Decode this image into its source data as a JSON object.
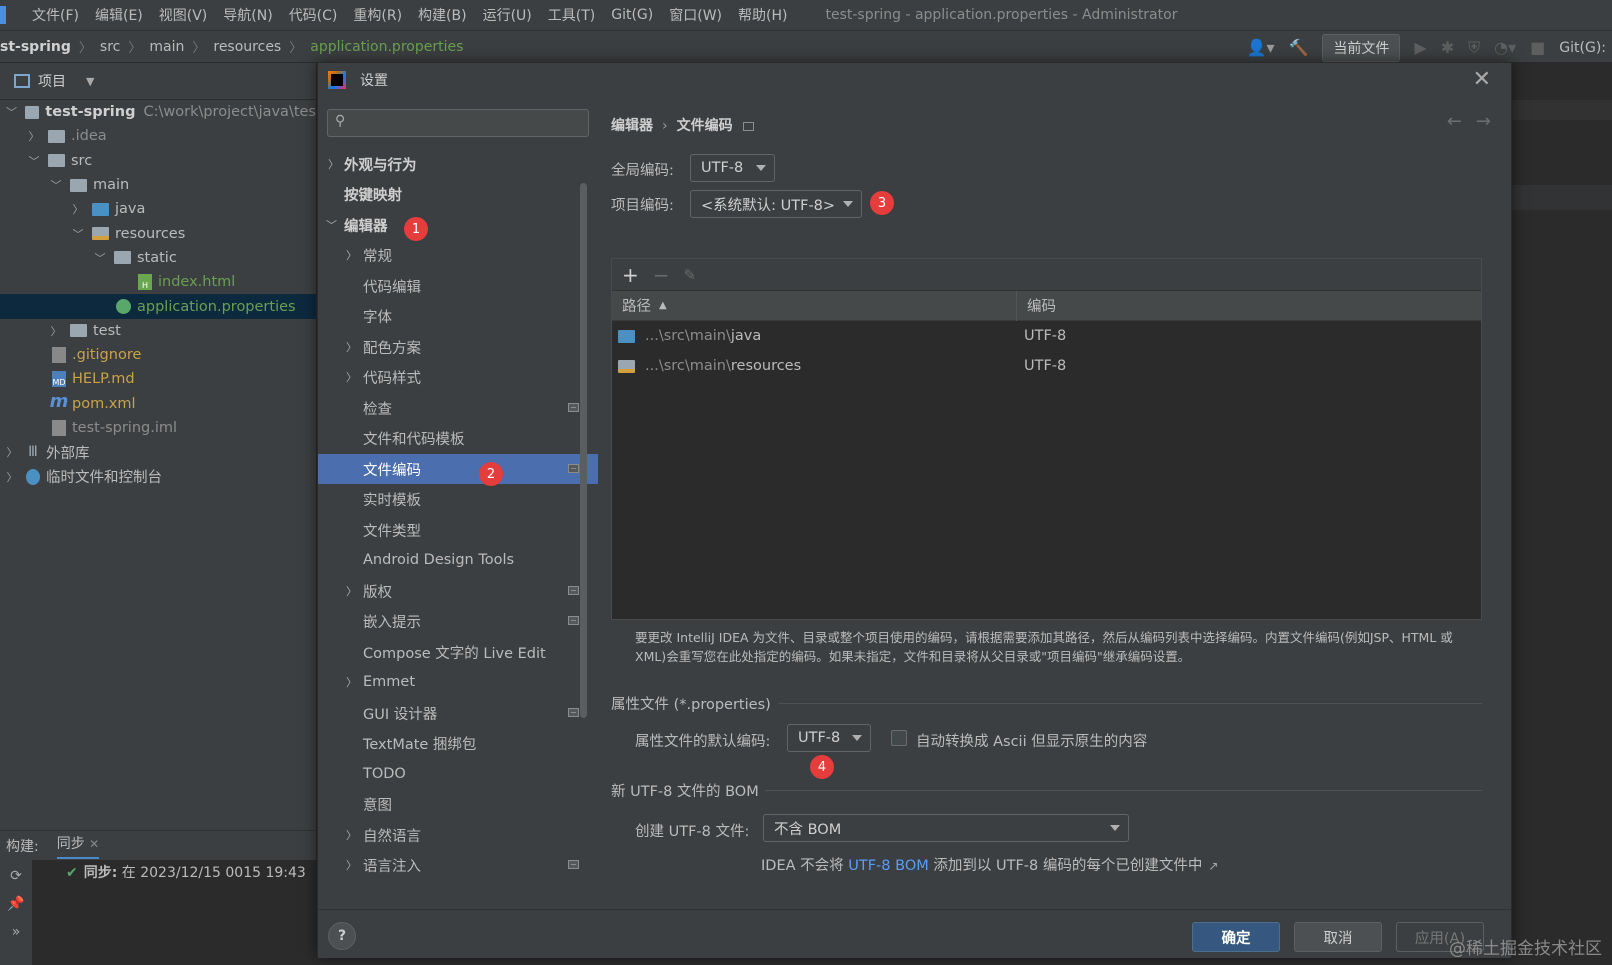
{
  "menubar": {
    "items": [
      "文件(F)",
      "编辑(E)",
      "视图(V)",
      "导航(N)",
      "代码(C)",
      "重构(R)",
      "构建(B)",
      "运行(U)",
      "工具(T)",
      "Git(G)",
      "窗口(W)",
      "帮助(H)"
    ],
    "window_title": "test-spring - application.properties - Administrator"
  },
  "navbar": {
    "crumbs": [
      "st-spring",
      "src",
      "main",
      "resources",
      "application.properties"
    ],
    "run_config": "当前文件",
    "git_label": "Git(G):"
  },
  "project_panel": {
    "title": "项目",
    "tree": [
      {
        "label": "test-spring",
        "path": "C:\\work\\project\\java\\tes"
      },
      {
        "label": ".idea"
      },
      {
        "label": "src"
      },
      {
        "label": "main"
      },
      {
        "label": "java"
      },
      {
        "label": "resources"
      },
      {
        "label": "static"
      },
      {
        "label": "index.html"
      },
      {
        "label": "application.properties"
      },
      {
        "label": "test"
      },
      {
        "label": ".gitignore"
      },
      {
        "label": "HELP.md"
      },
      {
        "label": "pom.xml"
      },
      {
        "label": "test-spring.iml"
      },
      {
        "label": "外部库"
      },
      {
        "label": "临时文件和控制台"
      }
    ]
  },
  "build_panel": {
    "tab_build": "构建:",
    "tab_sync": "同步",
    "line_label": "同步:",
    "line_text": "在 2023/12/15 0015 19:43"
  },
  "dialog": {
    "title": "设置",
    "search_placeholder": "",
    "nav": [
      "外观与行为",
      "按键映射",
      "编辑器",
      "常规",
      "代码编辑",
      "字体",
      "配色方案",
      "代码样式",
      "检查",
      "文件和代码模板",
      "文件编码",
      "实时模板",
      "文件类型",
      "Android Design Tools",
      "版权",
      "嵌入提示",
      "Compose 文字的 Live Edit",
      "Emmet",
      "GUI 设计器",
      "TextMate 捆绑包",
      "TODO",
      "意图",
      "自然语言",
      "语言注入"
    ],
    "badges": [
      "1",
      "2",
      "3",
      "4"
    ],
    "breadcrumb": {
      "parent": "编辑器",
      "current": "文件编码"
    },
    "global_encoding": {
      "label": "全局编码:",
      "value": "UTF-8"
    },
    "project_encoding": {
      "label": "项目编码:",
      "value": "<系统默认: UTF-8>"
    },
    "table": {
      "columns": [
        "路径",
        "编码"
      ],
      "rows": [
        {
          "path_prefix": "...\\src\\main\\",
          "path_name": "java",
          "encoding": "UTF-8"
        },
        {
          "path_prefix": "...\\src\\main\\",
          "path_name": "resources",
          "encoding": "UTF-8"
        }
      ]
    },
    "help_text": "要更改 IntelliJ IDEA 为文件、目录或整个项目使用的编码，请根据需要添加其路径，然后从编码列表中选择编码。内置文件编码(例如JSP、HTML 或 XML)会重写您在此处指定的编码。如果未指定，文件和目录将从父目录或\"项目编码\"继承编码设置。",
    "properties_section": "属性文件 (*.properties)",
    "properties_default": {
      "label": "属性文件的默认编码:",
      "value": "UTF-8"
    },
    "ascii_checkbox": {
      "label": "自动转换成 Ascii 但显示原生的内容",
      "checked": false
    },
    "bom_section": "新 UTF-8 文件的 BOM",
    "create_utf8": {
      "label": "创建 UTF-8 文件:",
      "value": "不含 BOM"
    },
    "bom_note": {
      "prefix": "IDEA 不会将 ",
      "link": "UTF-8 BOM",
      "suffix": " 添加到以 UTF-8 编码的每个已创建文件中",
      "ext": "↗"
    },
    "buttons": {
      "ok": "确定",
      "cancel": "取消",
      "apply": "应用(A)",
      "help": "?"
    }
  },
  "watermark": "@稀土掘金技术社区",
  "colors": {
    "accent": "#4b6eaf",
    "badge": "#e53c3c",
    "link": "#589df6",
    "primary_button": "#365880"
  }
}
